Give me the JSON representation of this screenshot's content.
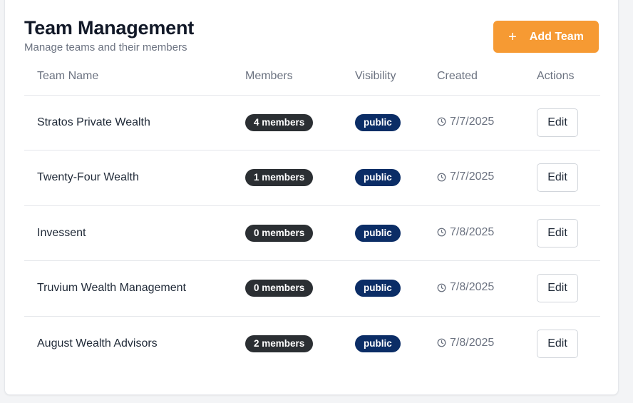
{
  "header": {
    "title": "Team Management",
    "subtitle": "Manage teams and their members",
    "add_button_label": "Add Team",
    "add_button_icon": "plus-icon"
  },
  "table": {
    "columns": [
      "Team Name",
      "Members",
      "Visibility",
      "Created",
      "Actions"
    ],
    "rows": [
      {
        "name": "Stratos Private Wealth",
        "members": "4 members",
        "visibility": "public",
        "created": "7/7/2025",
        "action": "Edit"
      },
      {
        "name": "Twenty-Four Wealth",
        "members": "1 members",
        "visibility": "public",
        "created": "7/7/2025",
        "action": "Edit"
      },
      {
        "name": "Invessent",
        "members": "0 members",
        "visibility": "public",
        "created": "7/8/2025",
        "action": "Edit"
      },
      {
        "name": "Truvium Wealth Management",
        "members": "0 members",
        "visibility": "public",
        "created": "7/8/2025",
        "action": "Edit"
      },
      {
        "name": "August Wealth Advisors",
        "members": "2 members",
        "visibility": "public",
        "created": "7/8/2025",
        "action": "Edit"
      }
    ]
  },
  "colors": {
    "accent": "#f69a33",
    "members_badge": "#2b2f33",
    "public_badge": "#0b2d66"
  }
}
